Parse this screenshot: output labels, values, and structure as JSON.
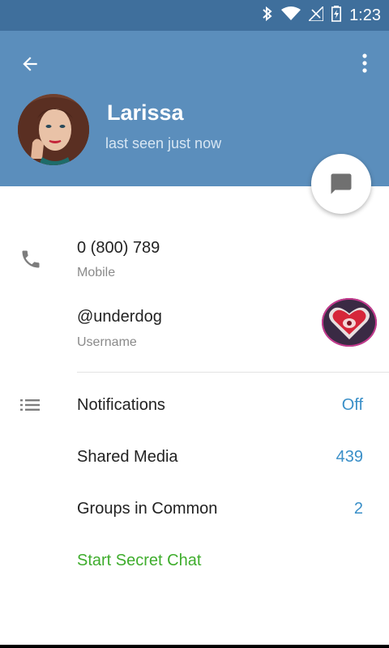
{
  "status_bar": {
    "time": "1:23"
  },
  "header": {
    "name": "Larissa",
    "status": "last seen just now"
  },
  "contact": {
    "phone": {
      "value": "0 (800) 789",
      "label": "Mobile"
    },
    "username": {
      "value": "@underdog",
      "label": "Username"
    }
  },
  "settings": {
    "notifications": {
      "label": "Notifications",
      "value": "Off"
    },
    "shared_media": {
      "label": "Shared Media",
      "value": "439"
    },
    "groups": {
      "label": "Groups in Common",
      "value": "2"
    },
    "secret_chat": {
      "label": "Start Secret Chat"
    }
  },
  "colors": {
    "header_bg": "#5b8ebc",
    "statusbar_bg": "#3f6f9c",
    "accent_blue": "#3a8fc8",
    "secret_green": "#3fad2d"
  },
  "icons": {
    "back": "arrow-left-icon",
    "more": "more-vertical-icon",
    "message": "message-icon",
    "phone": "phone-icon",
    "list": "list-icon",
    "bluetooth": "bluetooth-icon",
    "wifi": "wifi-icon",
    "signal": "signal-icon",
    "battery": "battery-icon"
  }
}
